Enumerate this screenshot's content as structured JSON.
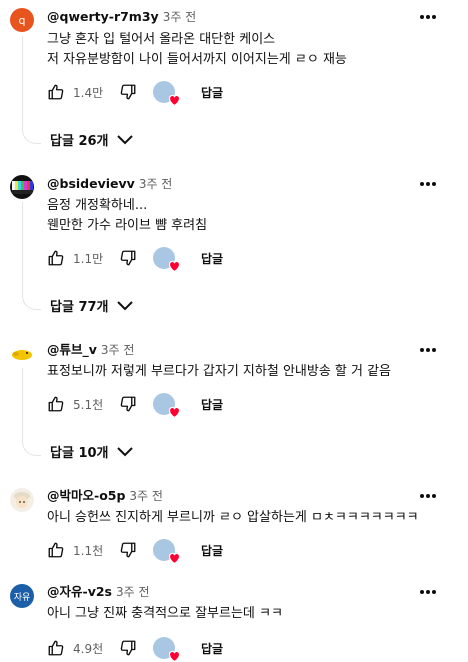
{
  "comments": [
    {
      "author": "@qwerty-r7m3y",
      "time": "3주 전",
      "avatar_letter": "q",
      "avatar_color": "#e8541e",
      "lines": [
        "그냥 혼자 입 털어서 올라온 대단한 케이스",
        "저 자유분방함이 나이 들어서까지 이어지는게 ㄹㅇ 재능"
      ],
      "likes": "1.4만",
      "reply_label": "답글",
      "replies_label": "답글 26개"
    },
    {
      "author": "@bsidevievv",
      "time": "3주 전",
      "lines": [
        "음정 개정확하네...",
        "웬만한 가수 라이브 뺨 후려침"
      ],
      "likes": "1.1만",
      "reply_label": "답글",
      "replies_label": "답글 77개"
    },
    {
      "author": "@튜브_v",
      "time": "3주 전",
      "lines": [
        "표정보니까 저렇게 부르다가 갑자기 지하철 안내방송 할 거 같음"
      ],
      "likes": "5.1천",
      "reply_label": "답글",
      "replies_label": "답글 10개"
    },
    {
      "author": "@박마오-o5p",
      "time": "3주 전",
      "lines": [
        "아니 승헌쓰 진지하게 부르니까 ㄹㅇ 압살하는게 ㅁㅊㅋㅋㅋㅋㅋㅋㅋ"
      ],
      "likes": "1.1천",
      "reply_label": "답글"
    },
    {
      "author": "@자유-v2s",
      "time": "3주 전",
      "avatar_letter": "자유",
      "avatar_color": "#1a5fa8",
      "lines": [
        "아니 그냥 진짜 충격적으로 잘부르는데 ㅋㅋ"
      ],
      "likes": "4.9천",
      "reply_label": "답글"
    }
  ],
  "colors": {
    "heart": "#ff0033",
    "text_secondary": "#606060"
  }
}
